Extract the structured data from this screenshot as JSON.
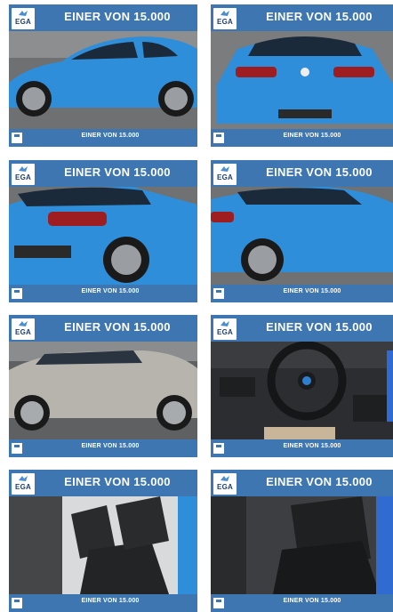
{
  "cards": [
    {
      "banner": "EINER VON 15.000",
      "logo": "EGA",
      "footer": "EINER VON 15.000",
      "photo": "car-side-blue"
    },
    {
      "banner": "EINER VON 15.000",
      "logo": "EGA",
      "footer": "EINER VON 15.000",
      "photo": "car-rear-blue"
    },
    {
      "banner": "EINER VON 15.000",
      "logo": "EGA",
      "footer": "EINER VON 15.000",
      "photo": "car-rear-quarter-blue"
    },
    {
      "banner": "EINER VON 15.000",
      "logo": "EGA",
      "footer": "EINER VON 15.000",
      "photo": "car-side-rear-blue"
    },
    {
      "banner": "EINER VON 15.000",
      "logo": "EGA",
      "footer": "EINER VON 15.000",
      "photo": "car-side-silver"
    },
    {
      "banner": "EINER VON 15.000",
      "logo": "EGA",
      "footer": "EINER VON 15.000",
      "photo": "steering-wheel-interior"
    },
    {
      "banner": "EINER VON 15.000",
      "logo": "EGA",
      "footer": "EINER VON 15.000",
      "photo": "front-seats-interior"
    },
    {
      "banner": "EINER VON 15.000",
      "logo": "EGA",
      "footer": "EINER VON 15.000",
      "photo": "rear-seats-interior"
    }
  ],
  "colors": {
    "banner": "#3d76b0",
    "car_blue": "#2f8ed9",
    "car_silver": "#b7b4ae"
  }
}
